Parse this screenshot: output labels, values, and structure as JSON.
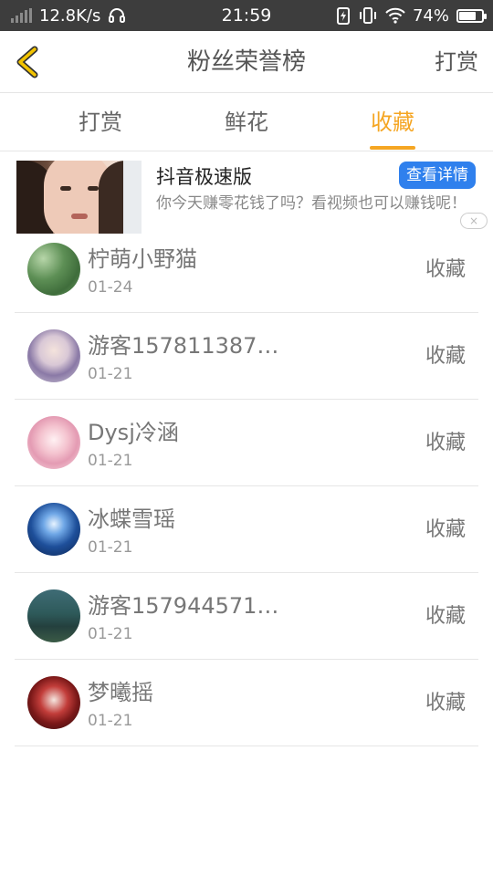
{
  "status_bar": {
    "network_speed": "12.8K/s",
    "time": "21:59",
    "battery_percent": "74%",
    "battery_level": 0.74
  },
  "header": {
    "title": "粉丝荣誉榜",
    "reward_label": "打赏"
  },
  "tabs": [
    {
      "label": "打赏",
      "active": false
    },
    {
      "label": "鲜花",
      "active": false
    },
    {
      "label": "收藏",
      "active": true
    }
  ],
  "ad": {
    "title": "抖音极速版",
    "detail_button": "查看详情",
    "description": "你今天赚零花钱了吗？看视频也可以赚钱呢！",
    "close_icon": "×"
  },
  "list": [
    {
      "name": "柠萌小野猫",
      "date": "01-24",
      "action": "收藏"
    },
    {
      "name": "游客157811387…",
      "date": "01-21",
      "action": "收藏"
    },
    {
      "name": "Dysj冷涵",
      "date": "01-21",
      "action": "收藏"
    },
    {
      "name": "冰蝶雪瑶",
      "date": "01-21",
      "action": "收藏"
    },
    {
      "name": "游客157944571…",
      "date": "01-21",
      "action": "收藏"
    },
    {
      "name": "梦曦摇",
      "date": "01-21",
      "action": "收藏"
    }
  ],
  "colors": {
    "accent": "#f5a623",
    "ad_button": "#2f80ed",
    "status_bar_bg": "#3d3d3d"
  }
}
